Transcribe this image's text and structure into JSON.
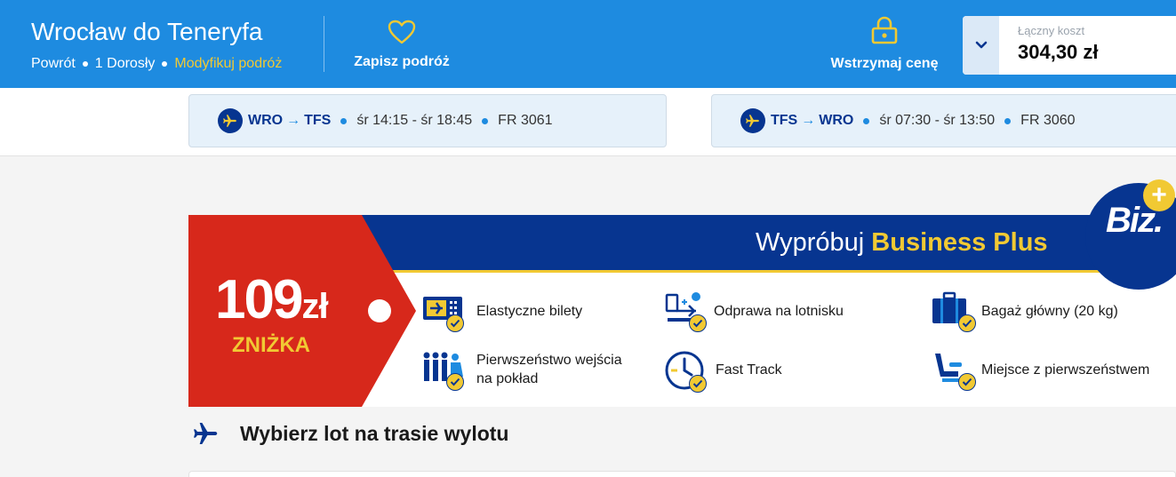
{
  "header": {
    "title": "Wrocław do Teneryfa",
    "trip_type": "Powrót",
    "passengers": "1 Dorosły",
    "modify_label": "Modyfikuj podróż",
    "save_label": "Zapisz podróż",
    "hold_label": "Wstrzymaj cenę",
    "total_caption": "Łączny koszt",
    "total_value": "304,30 zł"
  },
  "flights": [
    {
      "from": "WRO",
      "to": "TFS",
      "time": "śr 14:15 - śr 18:45",
      "number": "FR 3061"
    },
    {
      "from": "TFS",
      "to": "WRO",
      "time": "śr 07:30 - śr 13:50",
      "number": "FR 3060"
    }
  ],
  "banner": {
    "title_prefix": "Wypróbuj",
    "title_highlight": "Business Plus",
    "logo_text": "Biz.",
    "logo_plus": "+",
    "discount_amount": "109",
    "discount_currency": "zł",
    "discount_label": "ZNIŻKA",
    "features": [
      {
        "icon": "flexible-ticket-icon",
        "label": "Elastyczne bilety"
      },
      {
        "icon": "airport-checkin-icon",
        "label": "Odprawa na lotnisku"
      },
      {
        "icon": "checked-bag-icon",
        "label": "Bagaż główny (20 kg)"
      },
      {
        "icon": "priority-boarding-icon",
        "label_line1": "Pierwszeństwo wejścia",
        "label_line2": "na pokład"
      },
      {
        "icon": "fast-track-icon",
        "label": "Fast Track"
      },
      {
        "icon": "priority-seat-icon",
        "label": "Miejsce z pierwszeństwem"
      }
    ]
  },
  "section": {
    "title": "Wybierz lot na trasie wylotu"
  },
  "colors": {
    "primary_blue": "#1e8be0",
    "navy": "#073590",
    "yellow": "#f1c933",
    "tag_red": "#d7281b"
  }
}
